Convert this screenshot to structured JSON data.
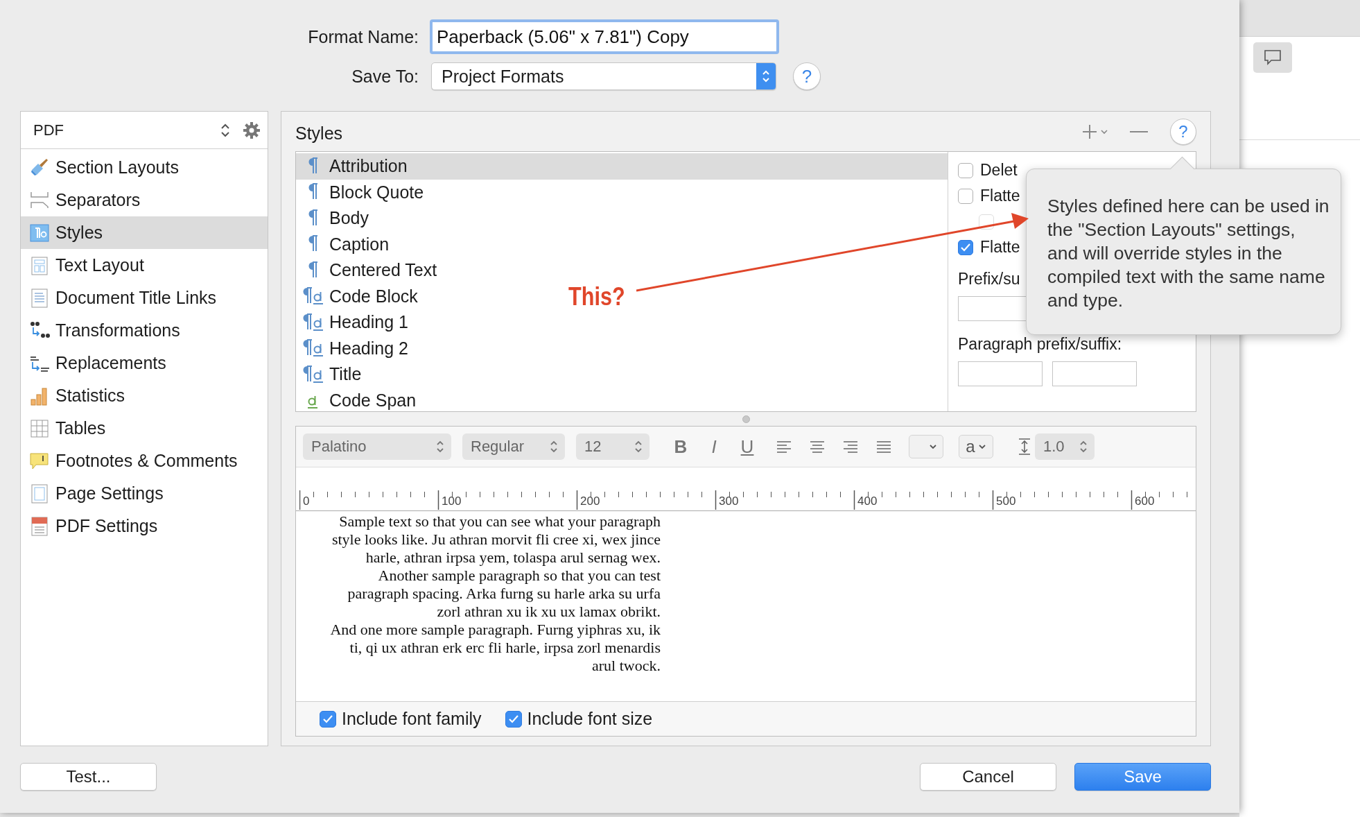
{
  "format_name": {
    "label": "Format Name:",
    "value": "Paperback (5.06\" x 7.81\") Copy"
  },
  "save_to": {
    "label": "Save To:",
    "value": "Project Formats",
    "help": "?"
  },
  "sidebar": {
    "format": "PDF",
    "items": [
      {
        "label": "Section Layouts",
        "selected": false
      },
      {
        "label": "Separators",
        "selected": false
      },
      {
        "label": "Styles",
        "selected": true
      },
      {
        "label": "Text Layout",
        "selected": false
      },
      {
        "label": "Document Title Links",
        "selected": false
      },
      {
        "label": "Transformations",
        "selected": false
      },
      {
        "label": "Replacements",
        "selected": false
      },
      {
        "label": "Statistics",
        "selected": false
      },
      {
        "label": "Tables",
        "selected": false
      },
      {
        "label": "Footnotes & Comments",
        "selected": false
      },
      {
        "label": "Page Settings",
        "selected": false
      },
      {
        "label": "PDF Settings",
        "selected": false
      }
    ]
  },
  "styles_panel": {
    "title": "Styles",
    "help": "?",
    "styles": [
      {
        "name": "Attribution",
        "kind": "paragraph",
        "selected": true
      },
      {
        "name": "Block Quote",
        "kind": "paragraph",
        "selected": false
      },
      {
        "name": "Body",
        "kind": "paragraph",
        "selected": false
      },
      {
        "name": "Caption",
        "kind": "paragraph",
        "selected": false
      },
      {
        "name": "Centered Text",
        "kind": "paragraph",
        "selected": false
      },
      {
        "name": "Code Block",
        "kind": "paragraph_character",
        "selected": false
      },
      {
        "name": "Heading 1",
        "kind": "paragraph_character",
        "selected": false
      },
      {
        "name": "Heading 2",
        "kind": "paragraph_character",
        "selected": false
      },
      {
        "name": "Title",
        "kind": "paragraph_character",
        "selected": false
      },
      {
        "name": "Code Span",
        "kind": "character",
        "selected": false
      }
    ],
    "options": [
      {
        "label": "Delet",
        "checked": false,
        "disabled": false
      },
      {
        "label": "Flatte",
        "checked": false,
        "disabled": false,
        "children": [
          {
            "checked": false,
            "disabled": true
          }
        ]
      },
      {
        "label": "Flatte",
        "checked": true,
        "disabled": false
      }
    ],
    "prefix_label": "Prefix/su",
    "paragraph_label": "Paragraph prefix/suffix:"
  },
  "editor": {
    "font": "Palatino",
    "weight": "Regular",
    "size": "12",
    "format_buttons": [
      "B",
      "I",
      "U"
    ],
    "case_popup": "a",
    "line_spacing": "1.0",
    "ruler": [
      "0",
      "100",
      "200",
      "300",
      "400",
      "500",
      "600"
    ],
    "sample_paragraphs": [
      "Sample text so that you can see what your paragraph style looks like. Ju athran morvit fli cree xi, wex jince harle, athran irpsa yem, tolaspa arul sernag wex.",
      "Another sample paragraph so that you can test paragraph spacing. Arka furng su harle arka su urfa zorl athran xu ik xu ux lamax obrikt.",
      "And one more sample paragraph. Furng yiphras xu, ik ti, qi ux athran erk erc fli harle, irpsa zorl menardis arul twock."
    ],
    "includes": [
      {
        "label": "Include font family",
        "checked": true
      },
      {
        "label": "Include font size",
        "checked": true
      }
    ]
  },
  "tooltip": {
    "text": "Styles defined here can be used in the \"Section Layouts\" settings, and will override styles in the compiled text with the same name and type."
  },
  "annotation": {
    "text": "This?"
  },
  "left_buttons": [
    {
      "label": "Test...",
      "default": false
    }
  ],
  "right_buttons": [
    {
      "label": "Cancel",
      "default": false
    },
    {
      "label": "Save",
      "default": true
    }
  ]
}
